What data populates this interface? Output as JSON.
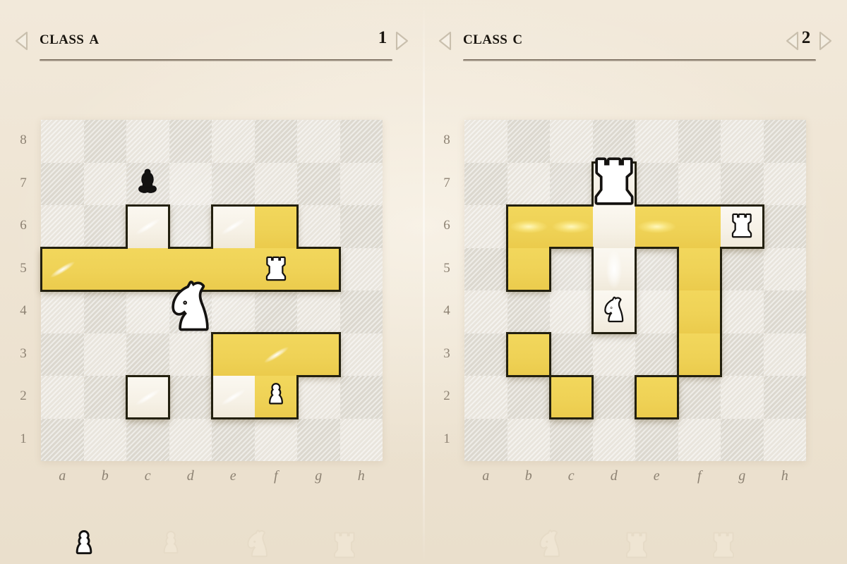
{
  "background_color": "#EFE6D6",
  "accent_highlight_color": "#EFD256",
  "pale_highlight_color": "#F8F3E8",
  "board": {
    "light_square_color": "#E9E5DD",
    "dark_square_color": "#DCD8CF",
    "files": [
      "a",
      "b",
      "c",
      "d",
      "e",
      "f",
      "g",
      "h"
    ],
    "ranks": [
      "8",
      "7",
      "6",
      "5",
      "4",
      "3",
      "2",
      "1"
    ]
  },
  "panels": [
    {
      "id": "left",
      "header": {
        "title": "Class A",
        "page": "1",
        "prev_title_icon": "chevron-left-icon",
        "next_title_icon": "chevron-right-icon",
        "prev_page_icon": "",
        "next_page_icon": "chevron-right-icon",
        "has_prev_page_chevron": false
      },
      "highlights": [
        {
          "square": "c6",
          "color": "white",
          "streak": "diag"
        },
        {
          "square": "a5",
          "color": "yellow",
          "streak": "diag"
        },
        {
          "square": "b5",
          "color": "yellow",
          "streak": "none"
        },
        {
          "square": "c5",
          "color": "yellow",
          "streak": "none"
        },
        {
          "square": "d5",
          "color": "yellow",
          "streak": "none"
        },
        {
          "square": "e6",
          "color": "white",
          "streak": "diag"
        },
        {
          "square": "f6",
          "color": "yellow",
          "streak": "none"
        },
        {
          "square": "e5",
          "color": "yellow",
          "streak": "none"
        },
        {
          "square": "f5",
          "color": "yellow",
          "streak": "none"
        },
        {
          "square": "g5",
          "color": "yellow",
          "streak": "none"
        },
        {
          "square": "e3",
          "color": "yellow",
          "streak": "none"
        },
        {
          "square": "f3",
          "color": "yellow",
          "streak": "diag"
        },
        {
          "square": "g3",
          "color": "yellow",
          "streak": "none"
        },
        {
          "square": "e2",
          "color": "white",
          "streak": "diag"
        },
        {
          "square": "f2",
          "color": "yellow",
          "streak": "none"
        },
        {
          "square": "c2",
          "color": "white",
          "streak": "diag"
        }
      ],
      "pieces": [
        {
          "square": "c7",
          "type": "bishop",
          "color": "black",
          "size": "small",
          "name": "black-bishop"
        },
        {
          "square": "f5",
          "type": "rook",
          "color": "white",
          "size": "small",
          "name": "white-rook"
        },
        {
          "square": "d4",
          "type": "knight",
          "color": "white",
          "size": "large",
          "name": "white-knight-selected"
        },
        {
          "square": "f2",
          "type": "pawn",
          "color": "white",
          "size": "small",
          "name": "white-pawn"
        }
      ],
      "tray": [
        {
          "type": "pawn",
          "state": "active",
          "name": "tray-pawn-active"
        },
        {
          "type": "pawn",
          "state": "ghost",
          "name": "tray-pawn-ghost"
        },
        {
          "type": "knight",
          "state": "ghost",
          "name": "tray-knight-ghost"
        },
        {
          "type": "rook",
          "state": "ghost",
          "name": "tray-rook-ghost"
        }
      ]
    },
    {
      "id": "right",
      "header": {
        "title": "Class C",
        "page": "2",
        "prev_title_icon": "chevron-left-icon",
        "next_title_icon": "",
        "prev_page_icon": "chevron-left-icon",
        "next_page_icon": "chevron-right-icon",
        "has_prev_page_chevron": true
      },
      "highlights": [
        {
          "square": "d7",
          "color": "white",
          "streak": "none"
        },
        {
          "square": "b6",
          "color": "yellow",
          "streak": "horiz"
        },
        {
          "square": "c6",
          "color": "yellow",
          "streak": "horiz"
        },
        {
          "square": "d6",
          "color": "white",
          "streak": "none"
        },
        {
          "square": "e6",
          "color": "yellow",
          "streak": "horiz"
        },
        {
          "square": "f6",
          "color": "yellow",
          "streak": "none"
        },
        {
          "square": "g6",
          "color": "white",
          "streak": "diag"
        },
        {
          "square": "b5",
          "color": "yellow",
          "streak": "none"
        },
        {
          "square": "d5",
          "color": "white",
          "streak": "vert"
        },
        {
          "square": "f5",
          "color": "yellow",
          "streak": "none"
        },
        {
          "square": "d4",
          "color": "white",
          "streak": "none"
        },
        {
          "square": "f4",
          "color": "yellow",
          "streak": "none"
        },
        {
          "square": "b3",
          "color": "yellow",
          "streak": "none"
        },
        {
          "square": "f3",
          "color": "yellow",
          "streak": "none"
        },
        {
          "square": "c2",
          "color": "yellow",
          "streak": "none"
        },
        {
          "square": "e2",
          "color": "yellow",
          "streak": "none"
        }
      ],
      "pieces": [
        {
          "square": "d7",
          "type": "rook",
          "color": "white",
          "size": "large",
          "name": "white-rook-selected"
        },
        {
          "square": "g6",
          "type": "rook",
          "color": "white",
          "size": "small",
          "name": "white-rook"
        },
        {
          "square": "d4",
          "type": "knight",
          "color": "white",
          "size": "small",
          "name": "white-knight"
        }
      ],
      "tray": [
        {
          "type": "knight",
          "state": "ghost",
          "name": "tray-knight-ghost"
        },
        {
          "type": "rook",
          "state": "ghost",
          "name": "tray-rook-ghost"
        },
        {
          "type": "rook",
          "state": "ghost",
          "name": "tray-rook-ghost-2"
        }
      ]
    }
  ]
}
